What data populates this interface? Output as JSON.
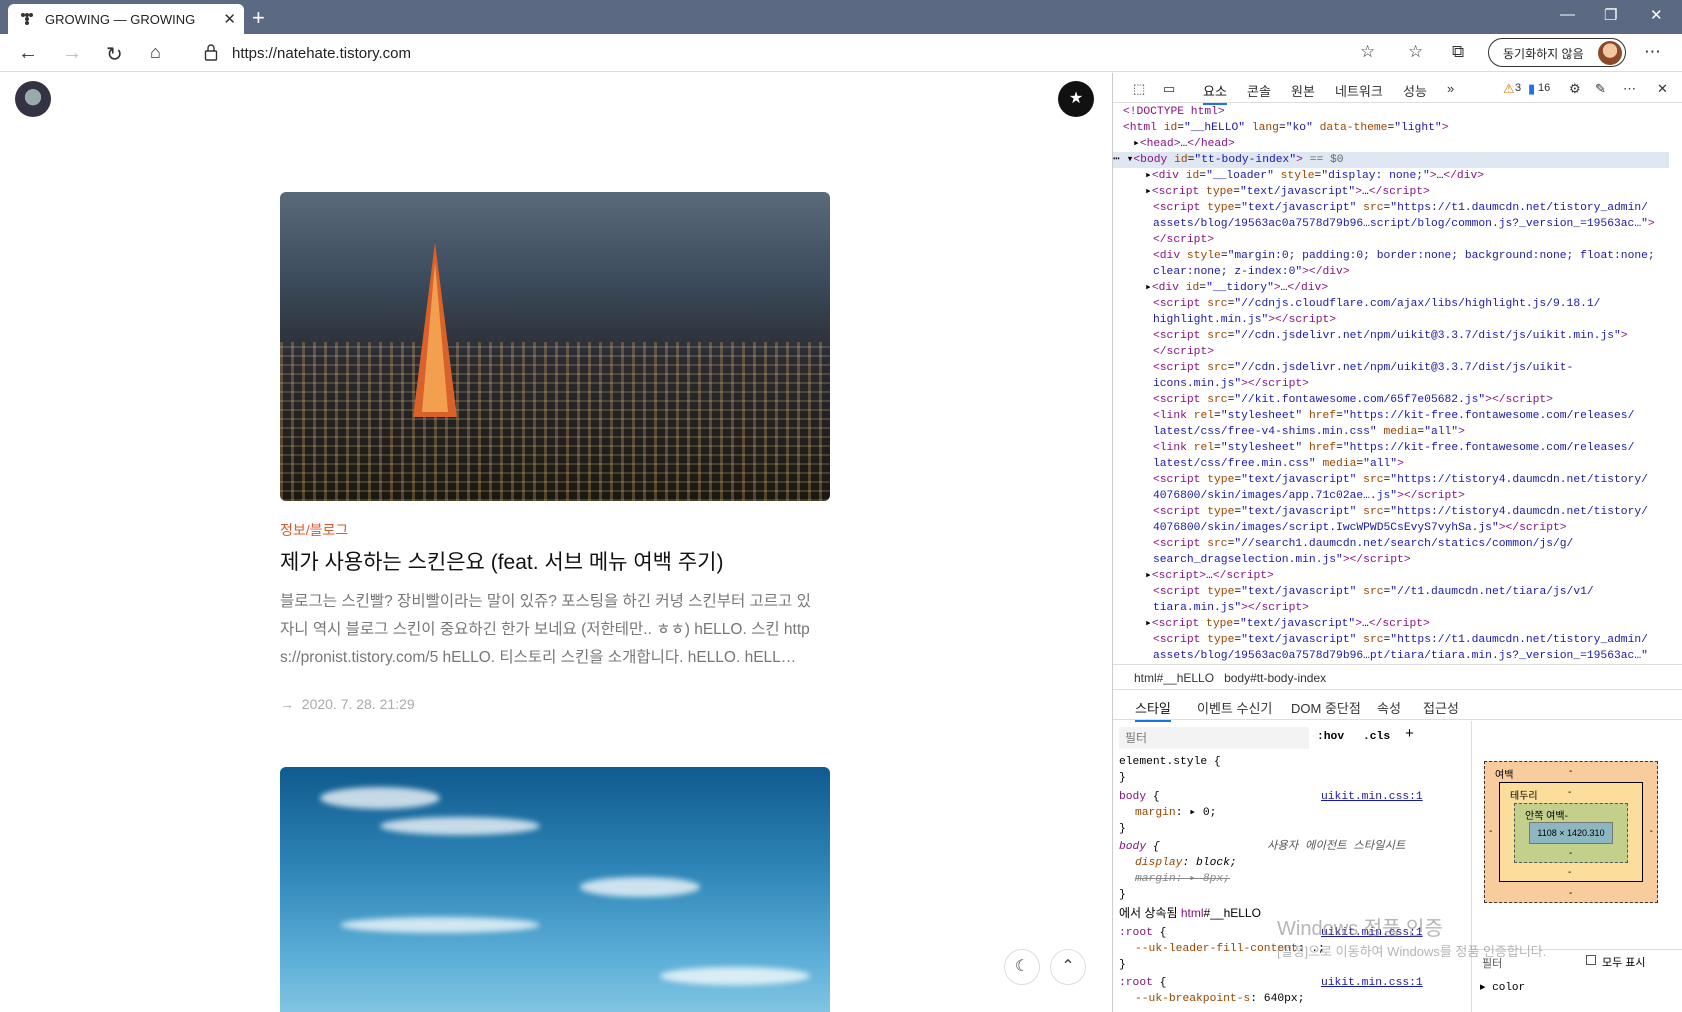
{
  "browser": {
    "tab_title": "GROWING — GROWING",
    "url": "https://natehate.tistory.com",
    "sync_label": "동기화하지 않음"
  },
  "post": {
    "category": "정보/블로그",
    "title": "제가 사용하는 스킨은요 (feat. 서브 메뉴 여백 주기)",
    "summary_lines": [
      "블로그는 스킨빨? 장비빨이라는 말이 있쥬? 포스팅을 하긴 커녕 스킨부터 고르고 있",
      "자니 역시 블로그 스킨이 중요하긴 한가 보네요 (저한테만.. ㅎㅎ) hELLO. 스킨 http",
      "s://pronist.tistory.com/5 hELLO. 티스토리 스킨을 소개합니다. hELLO. hELL…"
    ],
    "date": "2020. 7. 28. 21:29"
  },
  "devtools": {
    "tabs": [
      "요소",
      "콘솔",
      "원본",
      "네트워크",
      "성능"
    ],
    "warnings": "3",
    "messages": "16",
    "breadcrumb_html": "html#__hELLO",
    "breadcrumb_body": "body#tt-body-index",
    "sub_tabs": [
      "스타일",
      "이벤트 수신기",
      "DOM 중단점",
      "속성",
      "접근성"
    ],
    "filter_placeholder": "필터",
    "hov": ":hov",
    "cls": ".cls",
    "boxmodel": {
      "margin_label": "여백",
      "border_label": "테두리",
      "padding_label": "안쪽 여백-",
      "content_size": "1108 × 1420.310",
      "dash": "-"
    },
    "computed_filter": "필터",
    "show_all": "모두 표시",
    "computed_prop": "color"
  },
  "watermark": {
    "line1": "Windows 정품 인증",
    "line2": "[설정]으로 이동하여 Windows를 정품 인증합니다."
  }
}
